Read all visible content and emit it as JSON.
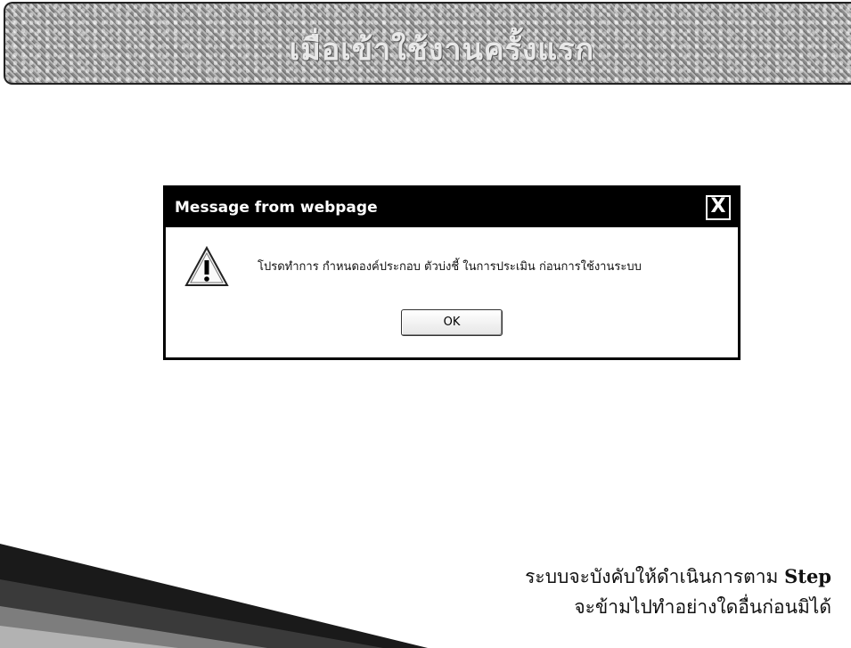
{
  "banner": {
    "title": "เมื่อเข้าใช้งานครั้งแรก"
  },
  "dialog": {
    "title": "Message from webpage",
    "close_label": "X",
    "message": "โปรดทำการ กำหนดองค์ประกอบ ตัวบ่งชี้ ในการประเมิน ก่อนการใช้งานระบบ",
    "ok_label": "OK",
    "icon": "warning-icon"
  },
  "caption": {
    "line1_prefix": "ระบบจะบังคับให้ดำเนินการตาม ",
    "line1_strong": "Step",
    "line2": "จะข้ามไปทำอย่างใดอื่นก่อนมิได้"
  }
}
